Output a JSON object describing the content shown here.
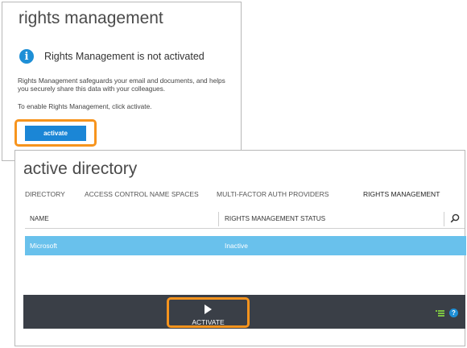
{
  "rights_panel": {
    "title": "rights management",
    "notice": "Rights Management is not activated",
    "description": "Rights Management safeguards your email and documents, and helps you securely share this data with your colleagues.",
    "enable_hint": "To enable Rights Management, click activate.",
    "activate_label": "activate",
    "info_glyph": "i"
  },
  "ad_panel": {
    "title": "active directory",
    "tabs": [
      {
        "label": "DIRECTORY",
        "active": false
      },
      {
        "label": "ACCESS CONTROL NAME SPACES",
        "active": false
      },
      {
        "label": "MULTI-FACTOR AUTH PROVIDERS",
        "active": false
      },
      {
        "label": "RIGHTS MANAGEMENT",
        "active": true
      }
    ],
    "columns": [
      "NAME",
      "RIGHTS MANAGEMENT STATUS"
    ],
    "rows": [
      {
        "name": "Microsoft",
        "status": "Inactive",
        "selected": true
      }
    ],
    "command_bar": {
      "activate_label": "ACTIVATE",
      "help_glyph": "?"
    }
  },
  "colors": {
    "accent_blue": "#1b86d6",
    "selected_row": "#69c1ec",
    "command_bar": "#3a3f47",
    "highlight_orange": "#f7941d",
    "list_icon_green": "#7cc242"
  },
  "icons": {
    "info": "info-icon",
    "search": "search-icon",
    "play": "play-icon",
    "list": "list-icon",
    "help": "help-icon"
  }
}
